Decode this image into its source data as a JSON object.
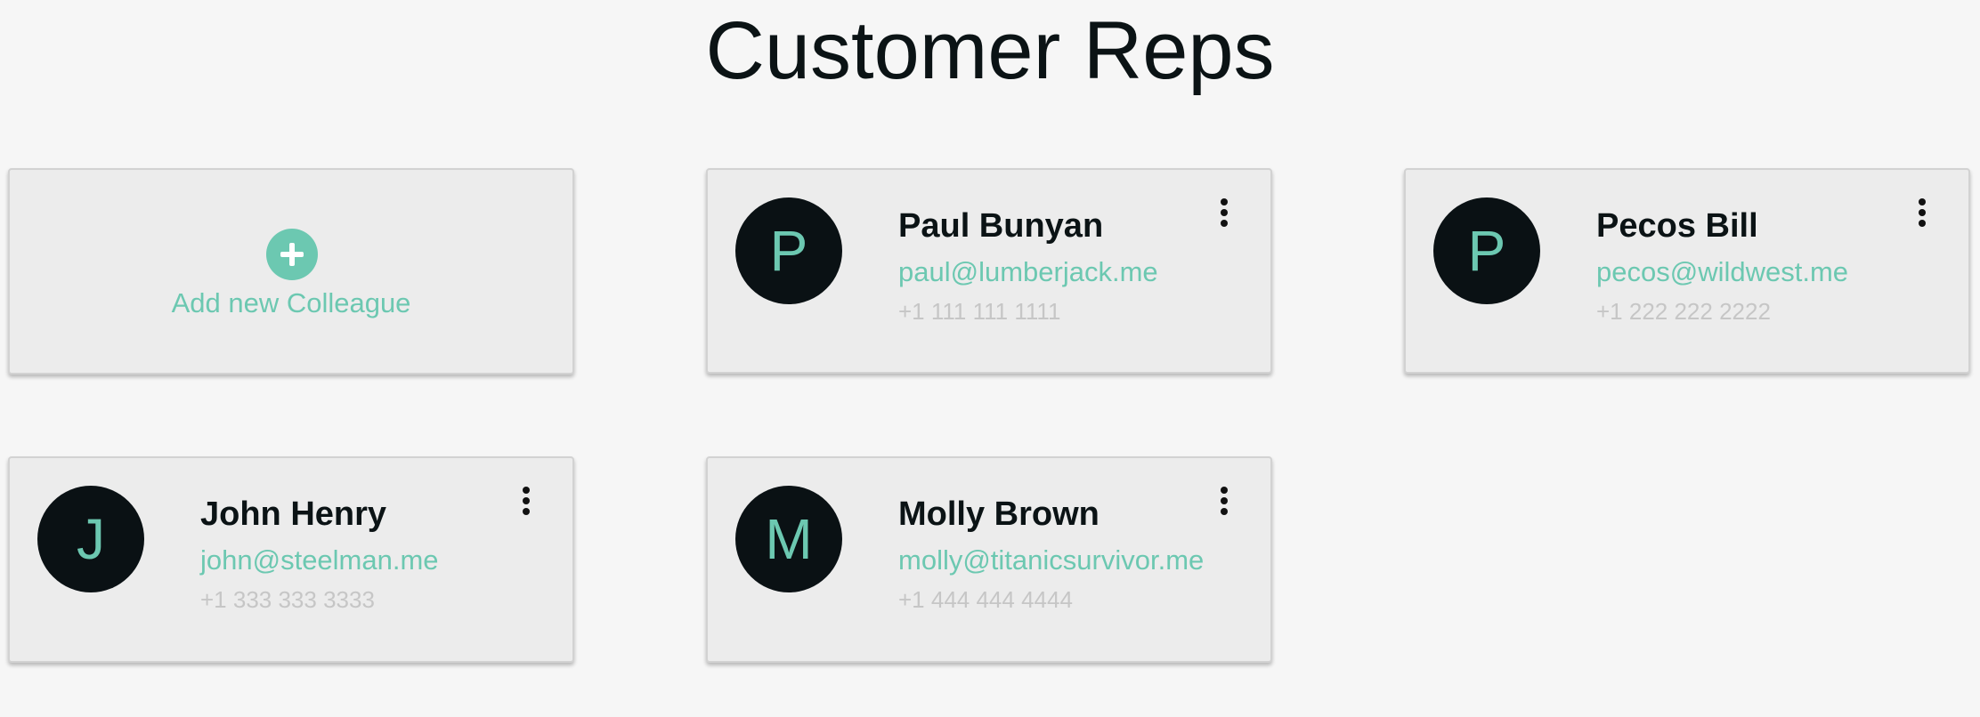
{
  "page": {
    "title": "Customer Reps"
  },
  "add_card": {
    "label": "Add new Colleague",
    "icon": "plus-circle-icon"
  },
  "reps": [
    {
      "initial": "P",
      "name": "Paul Bunyan",
      "email": "paul@lumberjack.me",
      "phone": "+1 111 111 1111"
    },
    {
      "initial": "P",
      "name": "Pecos Bill",
      "email": "pecos@wildwest.me",
      "phone": "+1 222 222 2222"
    },
    {
      "initial": "J",
      "name": "John Henry",
      "email": "john@steelman.me",
      "phone": "+1 333 333 3333"
    },
    {
      "initial": "M",
      "name": "Molly Brown",
      "email": "molly@titanicsurvivor.me",
      "phone": "+1 444 444 4444"
    }
  ],
  "colors": {
    "accent": "#6cc8b1",
    "avatar_bg": "#0a1114",
    "card_bg": "#ececec",
    "page_bg": "#f6f6f6",
    "phone_text": "#c6c6c6",
    "title_text": "#0b1315"
  }
}
